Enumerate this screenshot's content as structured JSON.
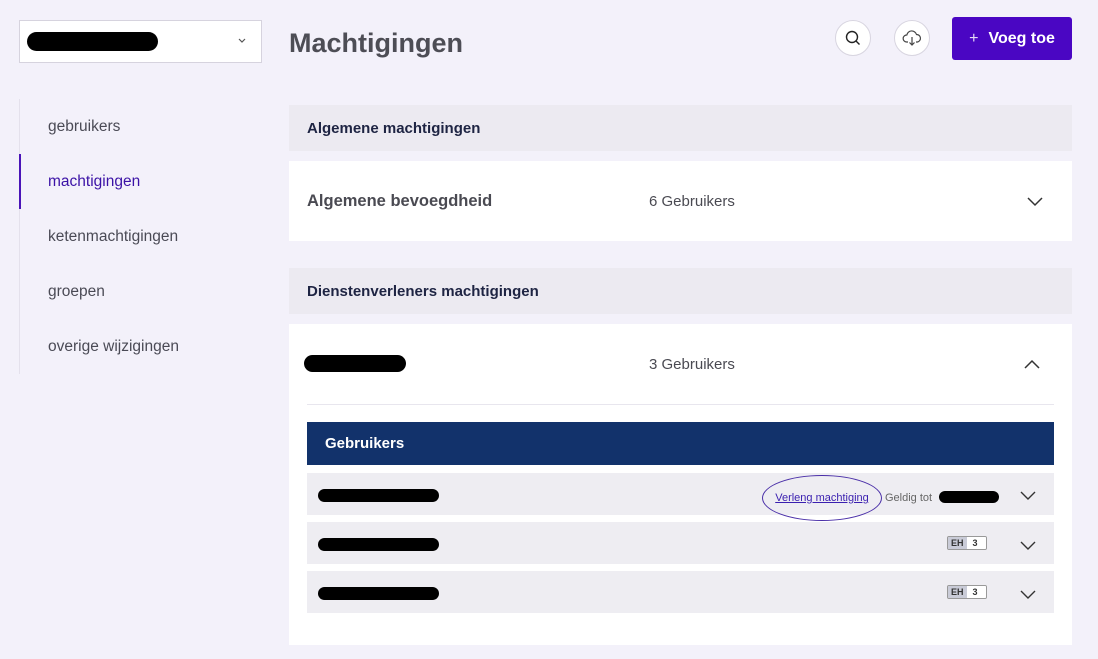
{
  "page": {
    "title": "Machtigingen"
  },
  "sidebar": {
    "items": [
      {
        "label": "gebruikers"
      },
      {
        "label": "machtigingen"
      },
      {
        "label": "ketenmachtigingen"
      },
      {
        "label": "groepen"
      },
      {
        "label": "overige wijzigingen"
      }
    ]
  },
  "toolbar": {
    "add_label": "Voeg toe",
    "search_icon": "search-icon",
    "download_icon": "cloud-download-icon"
  },
  "general": {
    "heading": "Algemene machtigingen",
    "card": {
      "title": "Algemene bevoegdheid",
      "count": "6 Gebruikers"
    }
  },
  "providers": {
    "heading": "Dienstenverleners machtigingen",
    "card": {
      "count": "3 Gebruikers",
      "users_heading": "Gebruikers",
      "rows": [
        {
          "renew_link": "Verleng machtiging",
          "valid_label": "Geldig tot"
        },
        {
          "badge_code": "EH",
          "badge_count": "3"
        },
        {
          "badge_code": "EH",
          "badge_count": "3"
        }
      ]
    }
  },
  "colors": {
    "accent": "#4a06c3",
    "header_navy": "#12326b",
    "background": "#f3f1fa"
  }
}
